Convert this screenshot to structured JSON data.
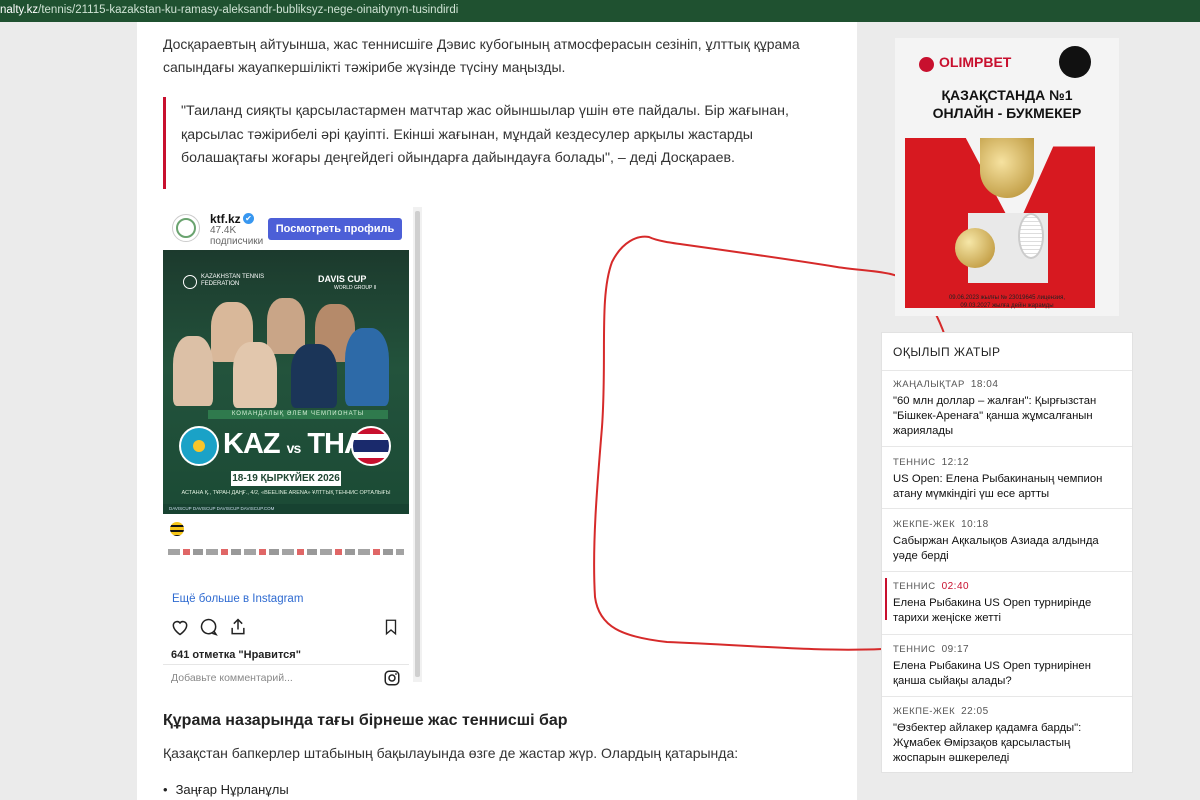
{
  "browser": {
    "url_host": "nalty.kz",
    "url_path": "/tennis/21115-kazakstan-ku-ramasy-aleksandr-bubliksyz-nege-oinaitynyn-tusindirdi"
  },
  "article": {
    "paragraph1": "Досқараевтың айтуынша, жас теннисшіге Дэвис кубогының атмосферасын сезініп, ұлттық құрама сапындағы жауапкершілікті тәжірибе жүзінде түсіну маңызды.",
    "quote": "\"Таиланд сияқты қарсыластармен матчтар жас ойыншылар үшін өте пайдалы. Бір жағынан, қарсылас тәжірибелі әрі қауіпті. Екінші жағынан, мұндай кездесулер арқылы жастарды болашақтағы жоғары деңгейдегі ойындарға дайындауға болады\", – деді Досқараев.",
    "subheading": "Құрама назарында тағы бірнеше жас теннисші бар",
    "paragraph2": "Қазақстан бапкерлер штабының бақылауында өзге де жастар жүр. Олардың қатарында:",
    "bullet1": "Заңғар Нұрланұлы"
  },
  "instagram": {
    "username": "ktf.kz",
    "verified_icon": "✔",
    "followers": "47.4K",
    "followers_label": "подписчики",
    "view_profile": "Посмотреть профиль",
    "more_link": "Ещё больше в Instagram",
    "likes": "641 отметка \"Нравится\"",
    "comment_placeholder": "Добавьте комментарий...",
    "poster": {
      "federation": "KAZAKHSTAN TENNIS FEDERATION",
      "davis_cup": "DAVIS CUP",
      "davis_group": "WORLD GROUP II",
      "band": "КОМАНДАЛЫҚ ӘЛЕМ ЧЕМПИОНАТЫ",
      "team1": "KAZ",
      "vs": "vs",
      "team2": "THA",
      "date": "18-19 ҚЫРКҮЙЕК 2026",
      "venue": "АСТАНА Қ., ТҰРАН ДАҢҒ., 4/2, «BEELINE ARENA» ҰЛТТЫҚ ТЕННИС ОРТАЛЫҒЫ",
      "social": "DAVISCUP     DAVISCUP     DAVISCUP     DAVISCUP.COM"
    }
  },
  "sidebar": {
    "ad": {
      "brand": "OLIMPBET",
      "headline_line1": "ҚАЗАҚСТАНДА №1",
      "headline_line2": "ОНЛАЙН - БУКМЕКЕР",
      "legal_line1": "09.06.2023 жылғы № 23019645 лицензия,",
      "legal_line2": "09.03.2027 жылға дейін жарамды"
    },
    "reading_title": "ОҚЫЛЫП ЖАТЫР",
    "items": [
      {
        "category": "ЖАҢАЛЫҚТАР",
        "time": "18:04",
        "text": "\"60 млн доллар – жалған\": Қырғызстан \"Бішкек-Аренаға\" қанша жұмсалғанын жариялады"
      },
      {
        "category": "ТЕННИС",
        "time": "12:12",
        "text": "US Open: Елена Рыбакинаның чемпион атану мүмкіндігі үш есе артты"
      },
      {
        "category": "ЖЕКПЕ-ЖЕК",
        "time": "10:18",
        "text": "Сабыржан Ақкалықов Азиада алдында уәде берді"
      },
      {
        "category": "ТЕННИС",
        "time": "02:40",
        "text": "Елена Рыбакина US Open турнирінде тарихи жеңіске жетті"
      },
      {
        "category": "ТЕННИС",
        "time": "09:17",
        "text": "Елена Рыбакина US Open турнирінен қанша сыйақы алады?"
      },
      {
        "category": "ЖЕКПЕ-ЖЕК",
        "time": "22:05",
        "text": "\"Өзбектер айлакер қадамға барды\": Жұмабек Өмірзақов қарсыластың жоспарын әшкереледі"
      }
    ]
  },
  "colors": {
    "accent": "#c8102e",
    "url_bar": "#1f5130",
    "instagram_button": "#4c5fd7",
    "link": "#2f6bd1"
  }
}
